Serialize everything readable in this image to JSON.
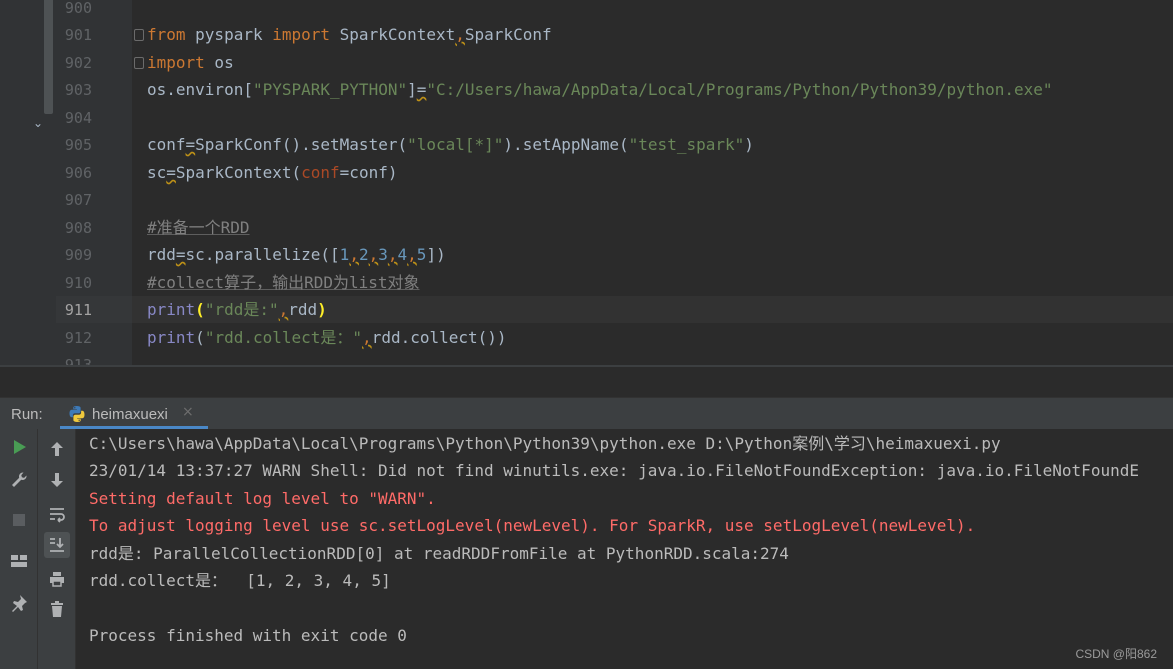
{
  "editor": {
    "line_numbers": [
      "900",
      "901",
      "902",
      "903",
      "904",
      "905",
      "906",
      "907",
      "908",
      "909",
      "910",
      "911",
      "912",
      "913"
    ],
    "current_line": "911",
    "lines": {
      "l901": {
        "kw1": "from",
        "mod": " pyspark ",
        "kw2": "import",
        "names1": " SparkContext",
        "comma": ",",
        "names2": "SparkConf"
      },
      "l902": {
        "kw": "import",
        "rest": " os"
      },
      "l903": {
        "a": "os.environ[",
        "key": "\"PYSPARK_PYTHON\"",
        "b": "]",
        "eq": "=",
        "val": "\"C:/Users/hawa/AppData/Local/Programs/Python/Python39/python.exe\""
      },
      "l905": {
        "a": "conf",
        "eq": "=",
        "b": "SparkConf().setMaster(",
        "s1": "\"local[*]\"",
        "c": ").setAppName(",
        "s2": "\"test_spark\"",
        "d": ")"
      },
      "l906": {
        "a": "sc",
        "eq": "=",
        "b": "SparkContext(",
        "p": "conf",
        "c": "=conf)"
      },
      "l908": {
        "comment": "#准备一个RDD"
      },
      "l909": {
        "a": "rdd",
        "eq": "=",
        "b": "sc.parallelize([",
        "n1": "1",
        "c1": ",",
        "n2": "2",
        "c2": ",",
        "n3": "3",
        "c3": ",",
        "n4": "4",
        "c4": ",",
        "n5": "5",
        "d": "])"
      },
      "l910": {
        "comment": "#collect算子，输出RDD为list对象"
      },
      "l911": {
        "fn": "print",
        "op": "(",
        "s": "\"rdd是:\"",
        "c": ",",
        "a": "rdd",
        "cp": ")"
      },
      "l912": {
        "fn": "print",
        "op": "(",
        "s": "\"rdd.collect是：\"",
        "c": ",",
        "a": "rdd.collect())"
      }
    }
  },
  "run_panel": {
    "label": "Run:",
    "tab_name": "heimaxuexi",
    "tab_close_glyph": "×",
    "toolbar_icons": [
      "run-icon",
      "wrench-icon",
      "stop-icon",
      "layout-icon",
      "pin-icon",
      "arrow-up-icon",
      "arrow-down-icon",
      "soft-wrap-icon",
      "scroll-to-end-icon",
      "print-icon",
      "trash-icon"
    ],
    "console": [
      "C:\\Users\\hawa\\AppData\\Local\\Programs\\Python\\Python39\\python.exe D:\\Python案例\\学习\\heimaxuexi.py",
      "23/01/14 13:37:27 WARN Shell: Did not find winutils.exe: java.io.FileNotFoundException: java.io.FileNotFoundE",
      "Setting default log level to \"WARN\".",
      "To adjust logging level use sc.setLogLevel(newLevel). For SparkR, use setLogLevel(newLevel).",
      "rdd是: ParallelCollectionRDD[0] at readRDDFromFile at PythonRDD.scala:274",
      "rdd.collect是：  [1, 2, 3, 4, 5]",
      "Process finished with exit code 0"
    ]
  },
  "colors": {
    "keyword": "#cc7832",
    "string": "#6a8759",
    "number": "#6897bb",
    "error": "#ff6b68",
    "accent": "#4a88c7"
  },
  "watermark": "CSDN @阳862"
}
